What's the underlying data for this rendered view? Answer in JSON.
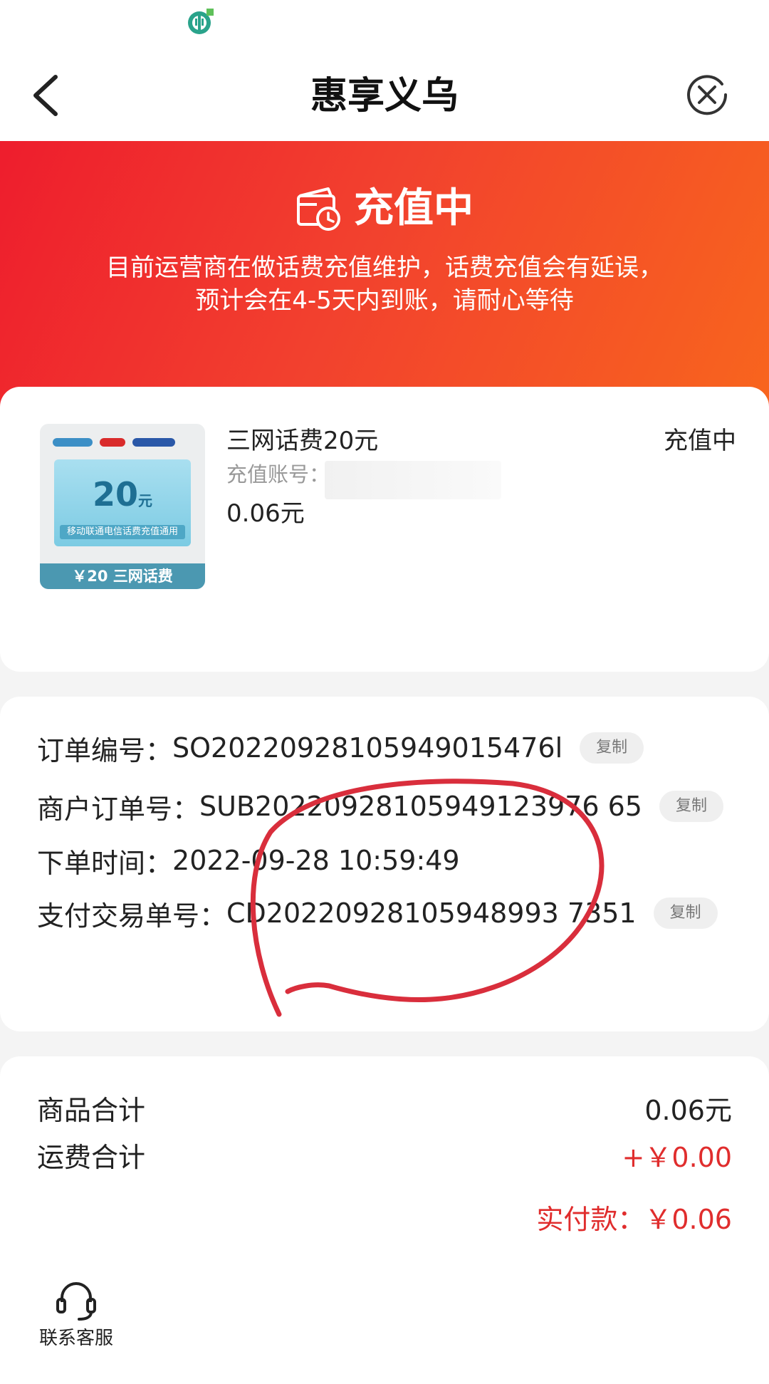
{
  "nav": {
    "title": "惠享义乌"
  },
  "banner": {
    "status": "充值中",
    "notice_line1": "目前运营商在做话费充值维护，话费充值会有延误，",
    "notice_line2": "预计会在4-5天内到账，请耐心等待"
  },
  "product": {
    "name": "三网话费20元",
    "account_label": "充值账号：",
    "price": "0.06元",
    "status": "充值中",
    "thumbnail": {
      "amount": "20",
      "unit": "元",
      "caption": "移动联通电信话费充值通用",
      "footer": "￥20 三网话费"
    }
  },
  "order": {
    "rows": [
      {
        "label": "订单编号：",
        "value": "SO20220928105949015476l",
        "copy": "复制"
      },
      {
        "label": "商户订单号：",
        "value": "SUB20220928105949123976 65",
        "copy": "复制"
      },
      {
        "label": "下单时间：",
        "value": "2022-09-28 10:59:49"
      },
      {
        "label": "支付交易单号：",
        "value": "CD20220928105948993 7351",
        "copy": "复制"
      }
    ]
  },
  "summary": {
    "goods_label": "商品合计",
    "goods_value": "0.06元",
    "shipping_label": "运费合计",
    "shipping_value": "+￥0.00",
    "paid_label": "实付款：",
    "paid_value": "￥0.06"
  },
  "service": {
    "label": "联系客服"
  },
  "colors": {
    "accent_red": "#e02d2d",
    "banner_start": "#ee1d2d",
    "banner_end": "#f8661d",
    "annotation": "#d92e3c"
  },
  "icons": [
    "back-arrow-icon",
    "close-icon",
    "wallet-clock-icon",
    "headset-icon",
    "bank-logo-icon"
  ]
}
